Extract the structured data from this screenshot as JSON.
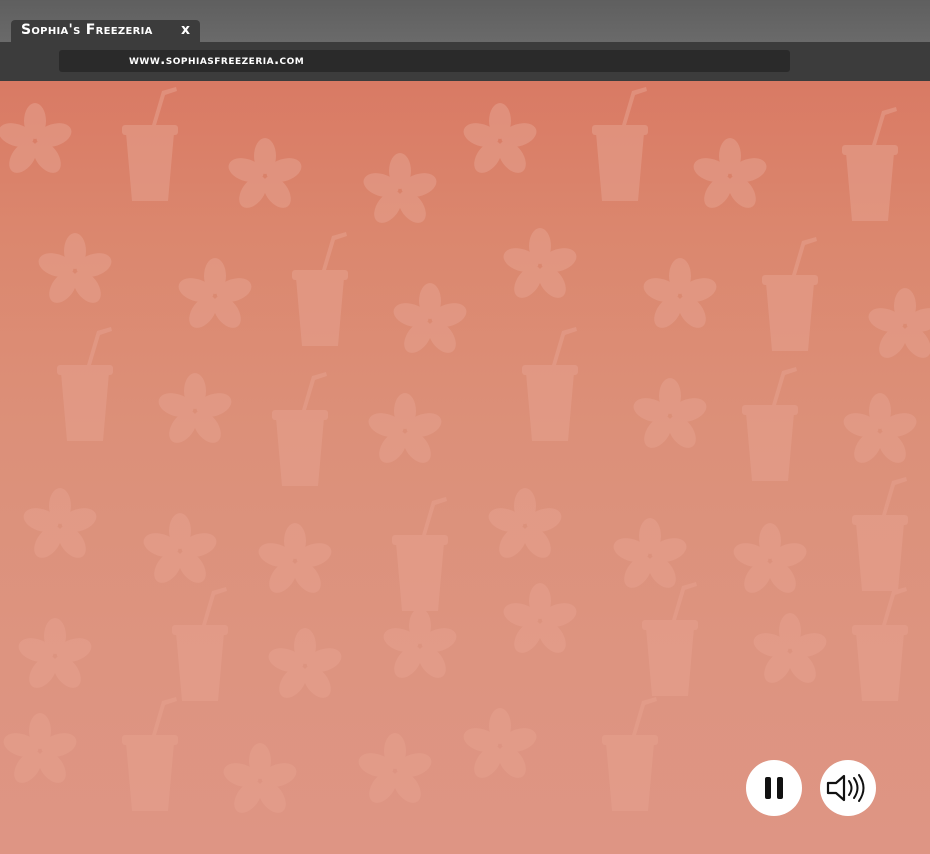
{
  "browser": {
    "tab_title": "Sophia's Freezeria",
    "tab_close": "x",
    "url": "www.sophiasfreezeria.com"
  },
  "game": {
    "background_colors": {
      "top": "#d97a64",
      "bottom": "#de9584",
      "pattern": "#e8a496"
    },
    "controls": {
      "pause_icon": "pause-icon",
      "sound_icon": "speaker-on-icon"
    }
  }
}
